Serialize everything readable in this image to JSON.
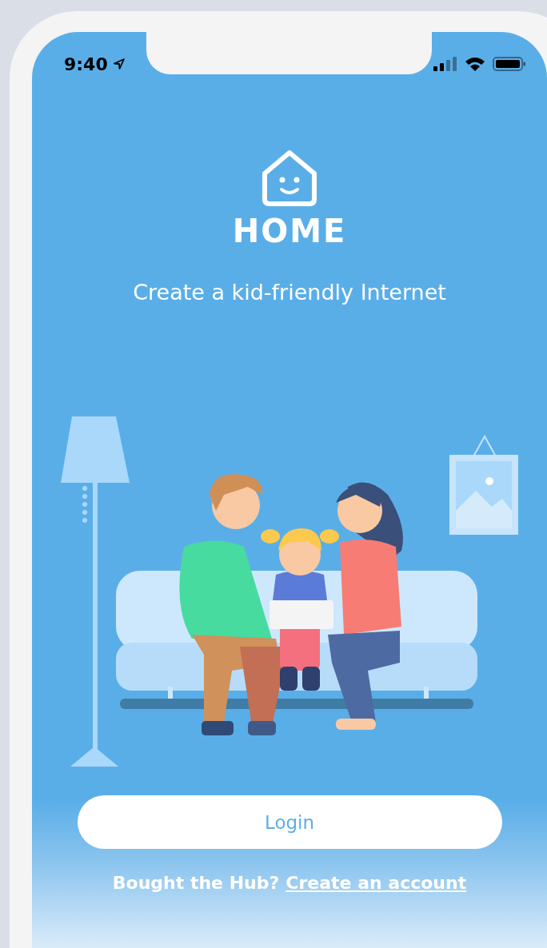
{
  "status_bar": {
    "time": "9:40"
  },
  "app": {
    "name": "HOME",
    "tagline": "Create a kid-friendly Internet"
  },
  "login_button": {
    "label": "Login"
  },
  "signup_prompt": {
    "text": "Bought the Hub?",
    "link": "Create an account"
  }
}
